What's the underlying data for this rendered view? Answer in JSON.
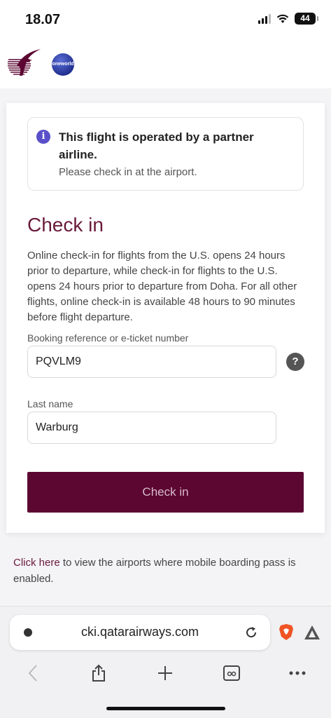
{
  "status": {
    "time": "18.07",
    "battery": "44"
  },
  "brand": {
    "oneworld": "oneworld"
  },
  "notice": {
    "title": "This flight is operated by a partner airline.",
    "subtitle": "Please check in at the airport."
  },
  "checkin": {
    "heading": "Check in",
    "description": "Online check-in for flights from the U.S. opens 24 hours prior to departure, while check-in for flights to the U.S. opens 24 hours prior to departure from Doha. For all other flights, online check-in is available 48 hours to 90 minutes before flight departure.",
    "booking_label": "Booking reference or e-ticket number",
    "booking_value": "PQVLM9",
    "lastname_label": "Last name",
    "lastname_value": "Warburg",
    "help": "?",
    "button": "Check in"
  },
  "footer": {
    "link": "Click here",
    "text": " to view the airports where mobile boarding pass is enabled."
  },
  "browser": {
    "url": "cki.qatarairways.com"
  },
  "colors": {
    "brand": "#5c0632",
    "heading": "#6a1a3a",
    "info": "#5a4fc9"
  }
}
